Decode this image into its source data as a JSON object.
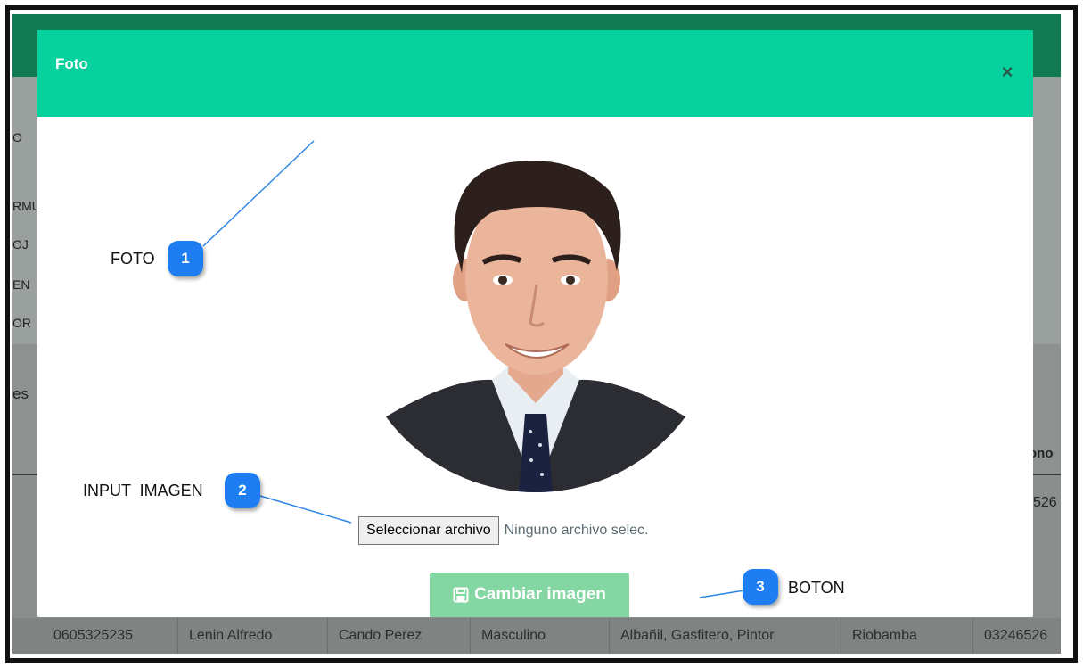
{
  "modal": {
    "title": "Foto",
    "close_symbol": "×",
    "file_button_label": "Seleccionar archivo",
    "file_status": "Ninguno archivo selec.",
    "save_label": "Cambiar imagen",
    "save_icon": "save-icon",
    "header_color": "#07d19c",
    "button_color": "#84d6a2"
  },
  "annotations": [
    {
      "number": "1",
      "label": "FOTO"
    },
    {
      "number": "2",
      "label": "INPUT  IMAGEN"
    },
    {
      "number": "3",
      "label": "BOTON"
    }
  ],
  "background": {
    "side_fragments": [
      "O",
      "RMU",
      "OJ",
      "EN",
      "OR"
    ],
    "section_fragment": "es",
    "table_header_fragment": "ono",
    "cell_fragment": "526",
    "row": [
      "0605325235",
      "Lenin Alfredo",
      "Cando Perez",
      "Masculino",
      "Albañil, Gasfitero, Pintor",
      "Riobamba",
      "03246526"
    ]
  }
}
